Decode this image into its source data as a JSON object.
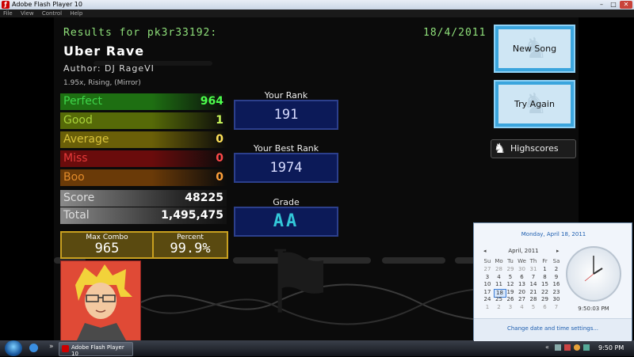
{
  "window": {
    "title": "Adobe Flash Player 10",
    "menu": [
      "File",
      "View",
      "Control",
      "Help"
    ]
  },
  "results": {
    "header": "Results for pk3r33192:",
    "date": "18/4/2011",
    "song_title": "Uber Rave",
    "author": "Author: DJ RageVI",
    "modifiers": "1.95x, Rising, (Mirror)"
  },
  "judgements": [
    {
      "name": "Perfect",
      "value": "964",
      "bg": "#1e6f12",
      "name_color": "#3ed64a",
      "value_color": "#4dff4d"
    },
    {
      "name": "Good",
      "value": "1",
      "bg": "#566a08",
      "name_color": "#a8d23a",
      "value_color": "#c8f55a"
    },
    {
      "name": "Average",
      "value": "0",
      "bg": "#6a5f08",
      "name_color": "#d8c23a",
      "value_color": "#ffe25a"
    },
    {
      "name": "Miss",
      "value": "0",
      "bg": "#6a0c0c",
      "name_color": "#e63a3a",
      "value_color": "#ff4a4a"
    },
    {
      "name": "Boo",
      "value": "0",
      "bg": "#6a3a08",
      "name_color": "#e08a2a",
      "value_color": "#ffa03a"
    }
  ],
  "score": {
    "label": "Score",
    "value": "48225"
  },
  "total": {
    "label": "Total",
    "value": "1,495,475"
  },
  "max_combo": {
    "label": "Max Combo",
    "value": "965"
  },
  "percent": {
    "label": "Percent",
    "value": "99.9%"
  },
  "ranks": {
    "your_rank_label": "Your Rank",
    "your_rank": "191",
    "best_rank_label": "Your Best Rank",
    "best_rank": "1974",
    "grade_label": "Grade",
    "grade": "AA"
  },
  "buttons": {
    "new_song": "New Song",
    "try_again": "Try Again",
    "highscores": "Highscores"
  },
  "calendar": {
    "long_date": "Monday, April 18, 2011",
    "month": "April, 2011",
    "weekdays": [
      "Su",
      "Mo",
      "Tu",
      "We",
      "Th",
      "Fr",
      "Sa"
    ],
    "days": [
      "27",
      "28",
      "29",
      "30",
      "31",
      "1",
      "2",
      "3",
      "4",
      "5",
      "6",
      "7",
      "8",
      "9",
      "10",
      "11",
      "12",
      "13",
      "14",
      "15",
      "16",
      "17",
      "18",
      "19",
      "20",
      "21",
      "22",
      "23",
      "24",
      "25",
      "26",
      "27",
      "28",
      "29",
      "30",
      "1",
      "2",
      "3",
      "4",
      "5",
      "6",
      "7"
    ],
    "selected_day": "18",
    "clock_time": "9:50:03 PM",
    "settings_link": "Change date and time settings..."
  },
  "taskbar": {
    "app_label": "Adobe Flash Player 10",
    "time": "9:50 PM"
  },
  "colors": {
    "title_green": "#8fe07a",
    "button_blue": "#3ba5dd",
    "grade_cyan": "#33c7d8",
    "stats_panel_border": "#c8a020"
  }
}
